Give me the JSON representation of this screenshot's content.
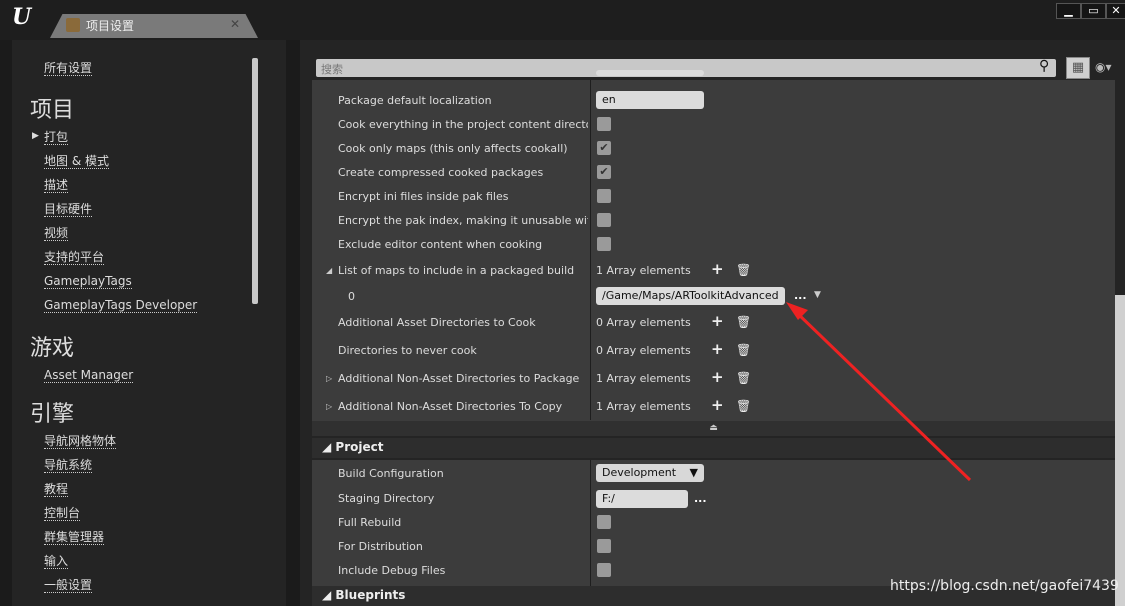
{
  "window": {
    "tab_title": "项目设置",
    "minimize": "▁",
    "maximize": "▭",
    "close": "✕",
    "logo": "U"
  },
  "sidebar": {
    "all_settings": "所有设置",
    "categories": [
      {
        "title": "项目",
        "items": [
          "打包",
          "地图 & 模式",
          "描述",
          "目标硬件",
          "视频",
          "支持的平台",
          "GameplayTags",
          "GameplayTags Developer"
        ]
      },
      {
        "title": "游戏",
        "items": [
          "Asset Manager"
        ]
      },
      {
        "title": "引擎",
        "items": [
          "导航网格物体",
          "导航系统",
          "教程",
          "控制台",
          "群集管理器",
          "输入",
          "一般设置"
        ]
      }
    ]
  },
  "search": {
    "placeholder": "搜索"
  },
  "packaging": {
    "rows": [
      {
        "label": "Package default localization",
        "type": "text",
        "value": "en"
      },
      {
        "label": "Cook everything in the project content directory (ignore list of maps below)",
        "type": "check",
        "checked": false
      },
      {
        "label": "Cook only maps (this only affects cookall)",
        "type": "check",
        "checked": true
      },
      {
        "label": "Create compressed cooked packages",
        "type": "check",
        "checked": true
      },
      {
        "label": "Encrypt ini files inside pak files",
        "type": "check",
        "checked": false
      },
      {
        "label": "Encrypt the pak index, making it unusable without the required key",
        "type": "check",
        "checked": false
      },
      {
        "label": "Exclude editor content when cooking",
        "type": "check",
        "checked": false
      }
    ],
    "arrays": [
      {
        "label": "List of maps to include in a packaged build",
        "value": "1 Array elements",
        "expander": "◢"
      },
      {
        "label": "Additional Asset Directories to Cook",
        "value": "0 Array elements",
        "expander": ""
      },
      {
        "label": "Directories to never cook",
        "value": "0 Array elements",
        "expander": ""
      },
      {
        "label": "Additional Non-Asset Directories to Package",
        "value": "1 Array elements",
        "expander": "▷"
      },
      {
        "label": "Additional Non-Asset Directories To Copy",
        "value": "1 Array elements",
        "expander": "▷"
      }
    ],
    "map_element": {
      "index": "0",
      "value": "/Game/Maps/ARToolkitAdvanced",
      "browse": "..."
    }
  },
  "project": {
    "title": "Project",
    "build_config_label": "Build Configuration",
    "build_config_value": "Development",
    "staging_label": "Staging Directory",
    "staging_value": "F:/",
    "browse": "...",
    "full_rebuild": "Full Rebuild",
    "for_distribution": "For Distribution",
    "include_debug": "Include Debug Files"
  },
  "blueprints": {
    "title": "Blueprints"
  },
  "watermark": "https://blog.csdn.net/gaofei7439",
  "colors": {
    "annotation_arrow": "#ee2222"
  }
}
